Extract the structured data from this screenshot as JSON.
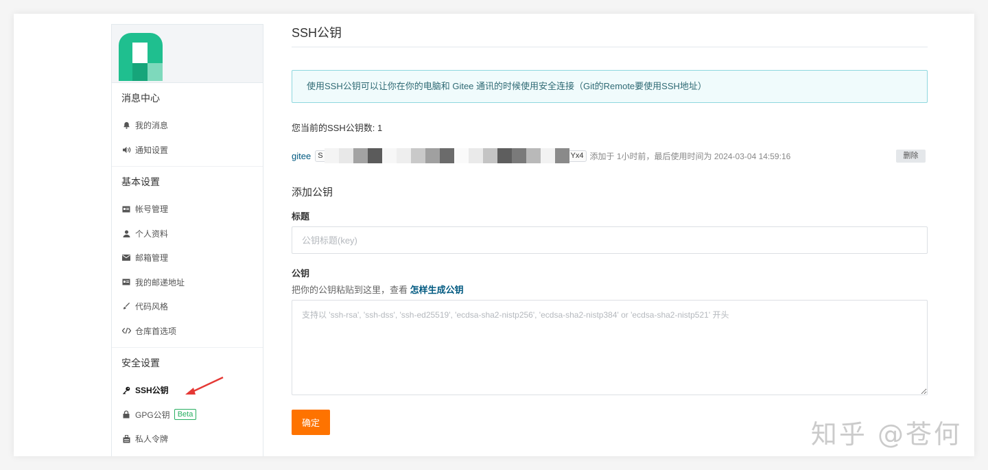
{
  "sidebar": {
    "groups": [
      {
        "title": "消息中心",
        "items": [
          {
            "label": "我的消息",
            "icon": "bell-icon"
          },
          {
            "label": "通知设置",
            "icon": "volume-icon"
          }
        ]
      },
      {
        "title": "基本设置",
        "items": [
          {
            "label": "帐号管理",
            "icon": "id-card-icon"
          },
          {
            "label": "个人资料",
            "icon": "user-icon"
          },
          {
            "label": "邮箱管理",
            "icon": "envelope-icon"
          },
          {
            "label": "我的邮递地址",
            "icon": "address-card-icon"
          },
          {
            "label": "代码风格",
            "icon": "brush-icon"
          },
          {
            "label": "仓库首选项",
            "icon": "code-icon"
          }
        ]
      },
      {
        "title": "安全设置",
        "items": [
          {
            "label": "SSH公钥",
            "icon": "key-icon",
            "active": true
          },
          {
            "label": "GPG公钥",
            "icon": "lock-icon",
            "badge": "Beta"
          },
          {
            "label": "私人令牌",
            "icon": "badge-icon"
          }
        ]
      }
    ]
  },
  "main": {
    "title": "SSH公钥",
    "notice": "使用SSH公钥可以让你在你的电脑和 Gitee 通讯的时候使用安全连接（Git的Remote要使用SSH地址）",
    "key_count": "您当前的SSH公钥数: 1",
    "keys": [
      {
        "name": "gitee",
        "fingerprint_prefix": "S",
        "fingerprint_suffix": "Yx4",
        "meta": "添加于 1小时前，最后使用时间为 2024-03-04 14:59:16",
        "delete_label": "删除"
      }
    ],
    "add_section_title": "添加公钥",
    "title_label": "标题",
    "title_placeholder": "公钥标题(key)",
    "key_label": "公钥",
    "key_hint": "把你的公钥粘贴到这里，查看 ",
    "key_hint_link": "怎样生成公钥",
    "key_placeholder": "支持以 'ssh-rsa', 'ssh-dss', 'ssh-ed25519', 'ecdsa-sha2-nistp256', 'ecdsa-sha2-nistp384' or 'ecdsa-sha2-nistp521' 开头",
    "submit_label": "确定"
  },
  "watermark": "知乎 @苍何",
  "colors": {
    "accent_orange": "#fe7300",
    "link_blue": "#005980",
    "notice_border": "#8dd7de",
    "beta_green": "#27ae60",
    "avatar_green": "#1fbf8f"
  }
}
